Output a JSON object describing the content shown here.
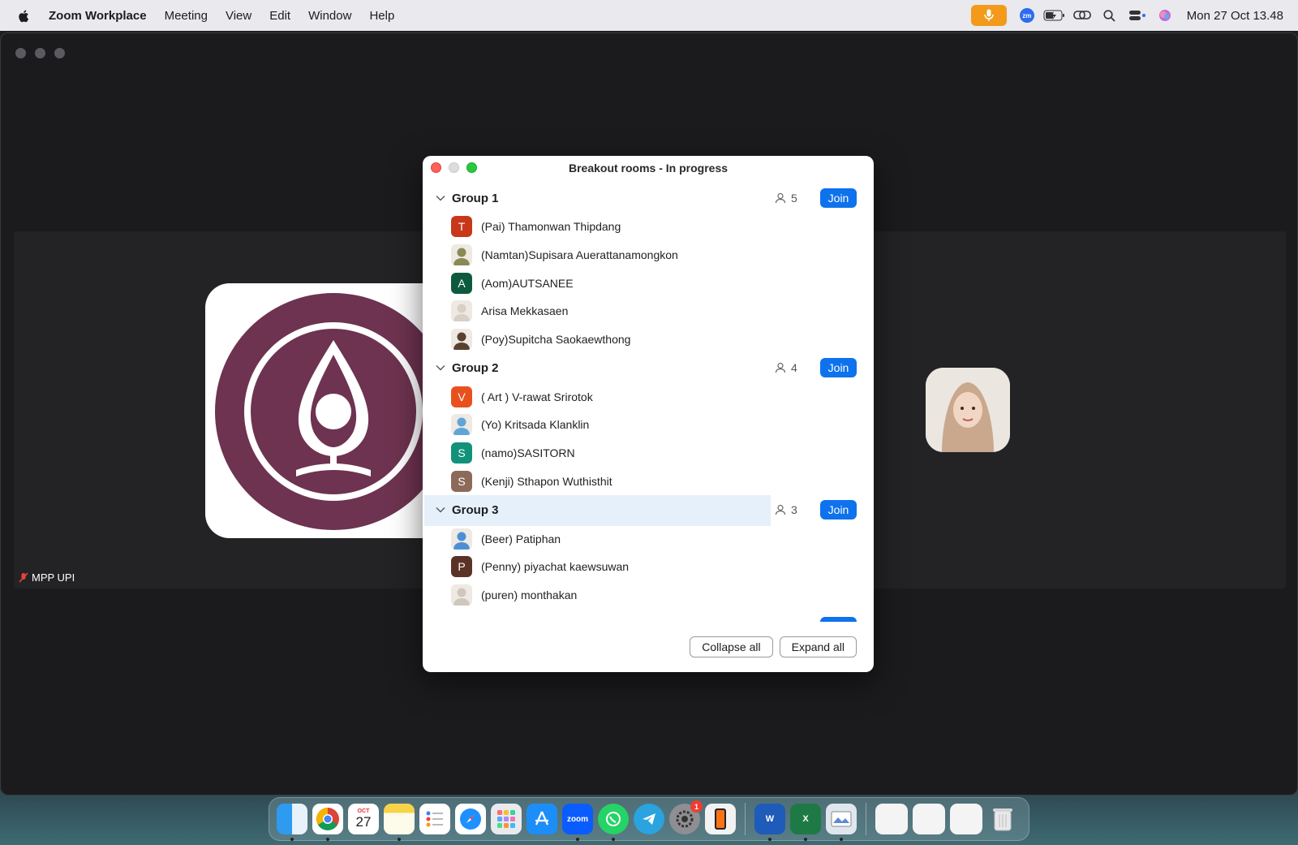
{
  "menubar": {
    "app_name": "Zoom Workplace",
    "menus": [
      "Meeting",
      "View",
      "Edit",
      "Window",
      "Help"
    ],
    "clock": "Mon 27 Oct  13.48",
    "zm_label": "zm"
  },
  "main_window": {
    "participant_name": "MPP UPI"
  },
  "dialog": {
    "title": "Breakout rooms - In progress",
    "join_label": "Join",
    "groups": [
      {
        "name": "Group 1",
        "count": "5",
        "members": [
          {
            "name": "(Pai) Thamonwan Thipdang",
            "initial": "T",
            "color": "#c8371a",
            "photo": false
          },
          {
            "name": "(Namtan)Supisara Auerattanamongkon",
            "initial": "",
            "color": "#8a8a55",
            "photo": true
          },
          {
            "name": "(Aom)AUTSANEE",
            "initial": "A",
            "color": "#0e5a3e",
            "photo": false
          },
          {
            "name": "Arisa Mekkasaen",
            "initial": "",
            "color": "#d8cfc5",
            "photo": true
          },
          {
            "name": "(Poy)Supitcha Saokaewthong",
            "initial": "",
            "color": "#5a4030",
            "photo": true
          }
        ]
      },
      {
        "name": "Group 2",
        "count": "4",
        "members": [
          {
            "name": "( Art ) V-rawat Srirotok",
            "initial": "V",
            "color": "#e8511e",
            "photo": false
          },
          {
            "name": "(Yo) Kritsada Klanklin",
            "initial": "",
            "color": "#5fa6d8",
            "photo": true
          },
          {
            "name": "(namo)SASITORN",
            "initial": "S",
            "color": "#12917a",
            "photo": false
          },
          {
            "name": "(Kenji) Sthapon Wuthisthit",
            "initial": "S",
            "color": "#8c6a5a",
            "photo": false
          }
        ]
      },
      {
        "name": "Group 3",
        "count": "3",
        "members": [
          {
            "name": "(Beer) Patiphan",
            "initial": "",
            "color": "#4d8fd6",
            "photo": true
          },
          {
            "name": "(Penny) piyachat kaewsuwan",
            "initial": "P",
            "color": "#5b3326",
            "photo": false
          },
          {
            "name": "(puren) monthakan",
            "initial": "",
            "color": "#cfc7bc",
            "photo": true
          }
        ]
      }
    ],
    "collapse_all": "Collapse all",
    "expand_all": "Expand all"
  },
  "dock": {
    "calendar_month": "OCT",
    "calendar_day": "27",
    "zoom_label": "zoom",
    "settings_badge": "1",
    "apps": [
      "finder",
      "chrome",
      "calendar",
      "notes",
      "reminders",
      "safari",
      "launchpad",
      "app-store",
      "zoom",
      "whatsapp",
      "telegram",
      "system-settings",
      "iphone-mirroring",
      "word",
      "excel",
      "preview",
      "document-1",
      "document-2",
      "document-3",
      "trash"
    ]
  },
  "colors": {
    "join_blue": "#0e72ed",
    "group_highlight": "#e6f0fb",
    "mic_orange": "#f39a1b",
    "logo_purple": "#6e3350"
  }
}
